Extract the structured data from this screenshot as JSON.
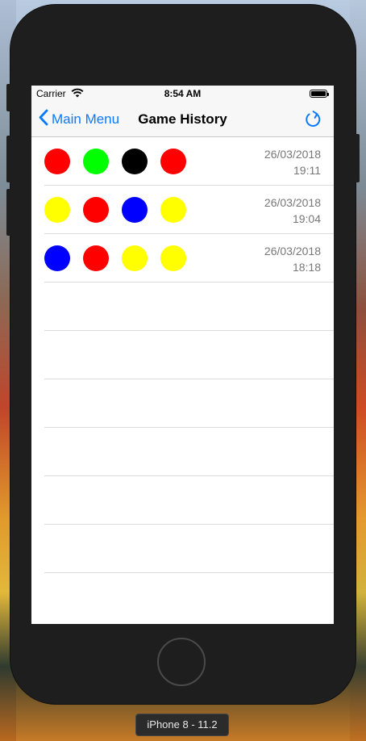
{
  "status_bar": {
    "carrier": "Carrier",
    "time": "8:54 AM"
  },
  "nav": {
    "back_label": "Main Menu",
    "title": "Game History",
    "accent_color": "#0a7aff"
  },
  "history": [
    {
      "colors": [
        "#ff0000",
        "#00ff00",
        "#000000",
        "#ff0000"
      ],
      "date": "26/03/2018",
      "time": "19:11"
    },
    {
      "colors": [
        "#ffff00",
        "#ff0000",
        "#0000ff",
        "#ffff00"
      ],
      "date": "26/03/2018",
      "time": "19:04"
    },
    {
      "colors": [
        "#0000ff",
        "#ff0000",
        "#ffff00",
        "#ffff00"
      ],
      "date": "26/03/2018",
      "time": "18:18"
    }
  ],
  "device_label": "iPhone 8 - 11.2"
}
